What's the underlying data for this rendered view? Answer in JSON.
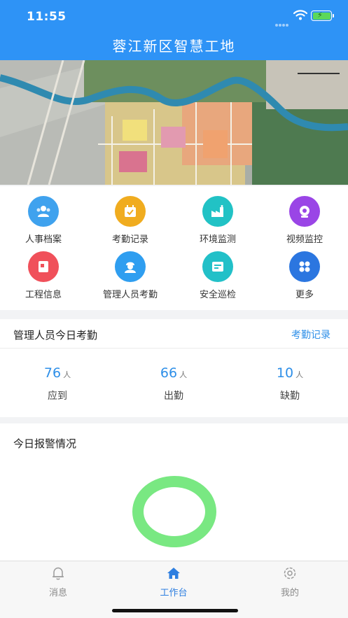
{
  "status_bar": {
    "time": "11:55"
  },
  "header": {
    "title": "蓉江新区智慧工地"
  },
  "grid": {
    "items": [
      {
        "label": "人事档案",
        "icon": "people-icon",
        "color": "#3fa2ee"
      },
      {
        "label": "考勤记录",
        "icon": "calendar-icon",
        "color": "#f0ac1f"
      },
      {
        "label": "环境监测",
        "icon": "factory-icon",
        "color": "#21c2c5"
      },
      {
        "label": "视频监控",
        "icon": "camera-icon",
        "color": "#9a45e6"
      },
      {
        "label": "工程信息",
        "icon": "document-icon",
        "color": "#f0505a"
      },
      {
        "label": "管理人员考勤",
        "icon": "worker-icon",
        "color": "#2f9ef0"
      },
      {
        "label": "安全巡检",
        "icon": "inspection-icon",
        "color": "#22c0c8"
      },
      {
        "label": "更多",
        "icon": "more-icon",
        "color": "#2b76e0"
      }
    ]
  },
  "attendance": {
    "title": "管理人员今日考勤",
    "link": "考勤记录",
    "stats": [
      {
        "value": "76",
        "unit": "人",
        "label": "应到"
      },
      {
        "value": "66",
        "unit": "人",
        "label": "出勤"
      },
      {
        "value": "10",
        "unit": "人",
        "label": "缺勤"
      }
    ]
  },
  "alarm": {
    "title": "今日报警情况",
    "ring_color": "#79e882"
  },
  "tabbar": {
    "tabs": [
      {
        "label": "消息",
        "icon": "bell-icon"
      },
      {
        "label": "工作台",
        "icon": "home-icon"
      },
      {
        "label": "我的",
        "icon": "settings-icon"
      }
    ]
  }
}
